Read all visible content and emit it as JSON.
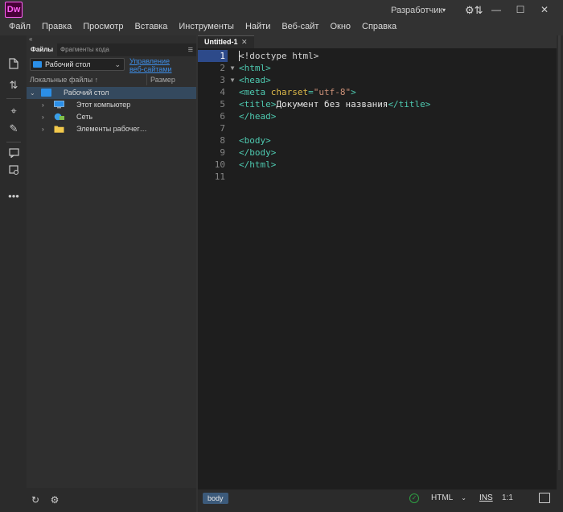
{
  "app": {
    "logo": "Dw",
    "workspace": "Разработчик"
  },
  "window_controls": {
    "minimize": "—",
    "maximize": "☐",
    "close": "✕"
  },
  "menu": [
    "Файл",
    "Правка",
    "Просмотр",
    "Вставка",
    "Инструменты",
    "Найти",
    "Веб-сайт",
    "Окно",
    "Справка"
  ],
  "left_toolbar": {
    "icons": [
      "file-icon",
      "sort-icon",
      "adjust-icon",
      "brush-icon",
      "comment-icon",
      "code-inspect-icon",
      "more-icon"
    ],
    "more_label": "•••"
  },
  "panel": {
    "tabs": [
      "Файлы",
      "Фрагменты кода"
    ],
    "site_select": "Рабочий стол",
    "manage_link_line1": "Управление",
    "manage_link_line2": "веб-сайтами",
    "column_local": "Локальные файлы ↑",
    "column_size": "Размер",
    "tree": [
      {
        "label": "Рабочий стол",
        "icon": "desktop-icon",
        "expanded": true,
        "selected": true
      },
      {
        "label": "Этот компьютер",
        "icon": "computer-icon",
        "expanded": false
      },
      {
        "label": "Сеть",
        "icon": "network-icon",
        "expanded": false
      },
      {
        "label": "Элементы рабочег…",
        "icon": "folder-icon",
        "expanded": false
      }
    ]
  },
  "editor": {
    "tab_label": "Untitled-1",
    "tab_close": "✕",
    "code_lines": [
      {
        "num": "1",
        "fold": "",
        "tokens": [
          [
            "plain",
            "<!doctype html>"
          ]
        ]
      },
      {
        "num": "2",
        "fold": "▼",
        "tokens": [
          [
            "tag",
            "<html>"
          ]
        ]
      },
      {
        "num": "3",
        "fold": "▼",
        "tokens": [
          [
            "tag",
            "<head>"
          ]
        ]
      },
      {
        "num": "4",
        "fold": "",
        "tokens": [
          [
            "tag",
            "<meta "
          ],
          [
            "attr",
            "charset"
          ],
          [
            "tag",
            "="
          ],
          [
            "val",
            "\"utf-8\""
          ],
          [
            "tag",
            ">"
          ]
        ]
      },
      {
        "num": "5",
        "fold": "",
        "tokens": [
          [
            "tag",
            "<title>"
          ],
          [
            "text",
            "Документ без названия"
          ],
          [
            "tag",
            "</title>"
          ]
        ]
      },
      {
        "num": "6",
        "fold": "",
        "tokens": [
          [
            "tag",
            "</head>"
          ]
        ]
      },
      {
        "num": "7",
        "fold": "",
        "tokens": []
      },
      {
        "num": "8",
        "fold": "",
        "tokens": [
          [
            "tag",
            "<body>"
          ]
        ]
      },
      {
        "num": "9",
        "fold": "",
        "tokens": [
          [
            "tag",
            "</body>"
          ]
        ]
      },
      {
        "num": "10",
        "fold": "",
        "tokens": [
          [
            "tag",
            "</html>"
          ]
        ]
      },
      {
        "num": "11",
        "fold": "",
        "tokens": []
      }
    ],
    "active_line": "1"
  },
  "statusbar": {
    "tag": "body",
    "language": "HTML",
    "mode": "INS",
    "position": "1:1"
  },
  "colors": {
    "accent": "#2d4a8a",
    "tag": "#4ec9b0",
    "attr": "#dcb94a",
    "value": "#ce9178",
    "status_ok": "#2ea043"
  }
}
